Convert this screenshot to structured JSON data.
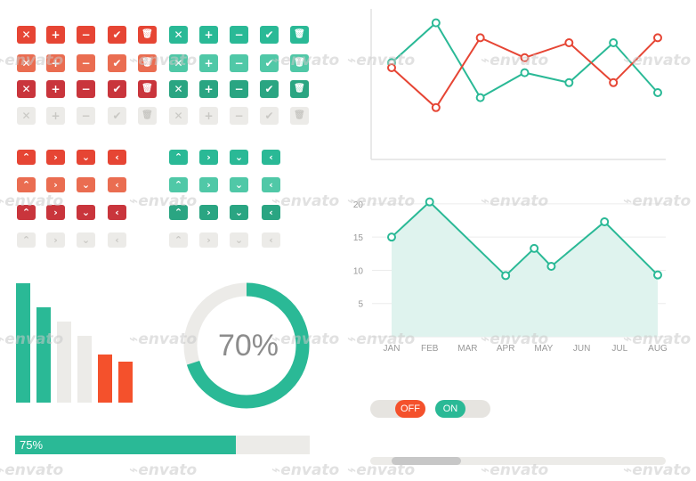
{
  "colors": {
    "red": "#ea6d51",
    "red_dark": "#e64534",
    "red_deep": "#c9353c",
    "teal": "#2ab996",
    "teal_light": "#50c8a7",
    "teal_dark": "#2aa582",
    "grey": "#ecebe8",
    "grey_icon": "#c9c8c4",
    "area_fill": "#dff3ee",
    "orange": "#f4512c"
  },
  "icon_buttons": {
    "red_set": [
      "close-icon",
      "plus-icon",
      "minus-icon",
      "check-icon",
      "trash-icon"
    ],
    "teal_set": [
      "close-icon",
      "plus-icon",
      "minus-icon",
      "check-icon",
      "trash-icon"
    ],
    "glyphs": {
      "close-icon": "✕",
      "plus-icon": "+",
      "minus-icon": "−",
      "check-icon": "✔",
      "trash-icon": "🗑"
    }
  },
  "arrow_tabs": {
    "set": [
      "chevron-up-icon",
      "chevron-right-icon",
      "chevron-down-icon",
      "chevron-left-icon"
    ],
    "glyphs": {
      "chevron-up-icon": "⌃",
      "chevron-right-icon": "›",
      "chevron-down-icon": "⌄",
      "chevron-left-icon": "‹"
    }
  },
  "bar_chart": {
    "values": [
      100,
      80,
      68,
      56,
      40,
      34
    ]
  },
  "donut": {
    "percent": 70,
    "label": "70%"
  },
  "progress": {
    "value": 75,
    "label": "75%"
  },
  "chart_data": [
    {
      "type": "line",
      "series": [
        {
          "color": "#2ab996",
          "values": [
            11,
            19,
            4,
            9,
            7,
            15,
            5
          ]
        },
        {
          "color": "#e64534",
          "values": [
            10,
            2,
            16,
            12,
            15,
            7,
            16
          ]
        }
      ],
      "ylim": [
        0,
        20
      ]
    },
    {
      "type": "area",
      "categories": [
        "JAN",
        "FEB",
        "MAR",
        "APR",
        "MAY",
        "JUN",
        "JUL",
        "AUG"
      ],
      "x": [
        "JAN",
        "FEB",
        "APR",
        "MAY",
        "MAY",
        "JUL",
        "AUG"
      ],
      "x_positions": [
        0,
        1,
        3,
        3.75,
        4.2,
        5.6,
        7
      ],
      "values": [
        15,
        20.3,
        9.2,
        13.3,
        10.6,
        17.3,
        9.3
      ],
      "yticks": [
        5,
        10,
        15,
        20
      ],
      "ylim": [
        0,
        22
      ],
      "grid": true
    }
  ],
  "toggles": {
    "off_label": "OFF",
    "on_label": "ON"
  },
  "watermark": "envato"
}
